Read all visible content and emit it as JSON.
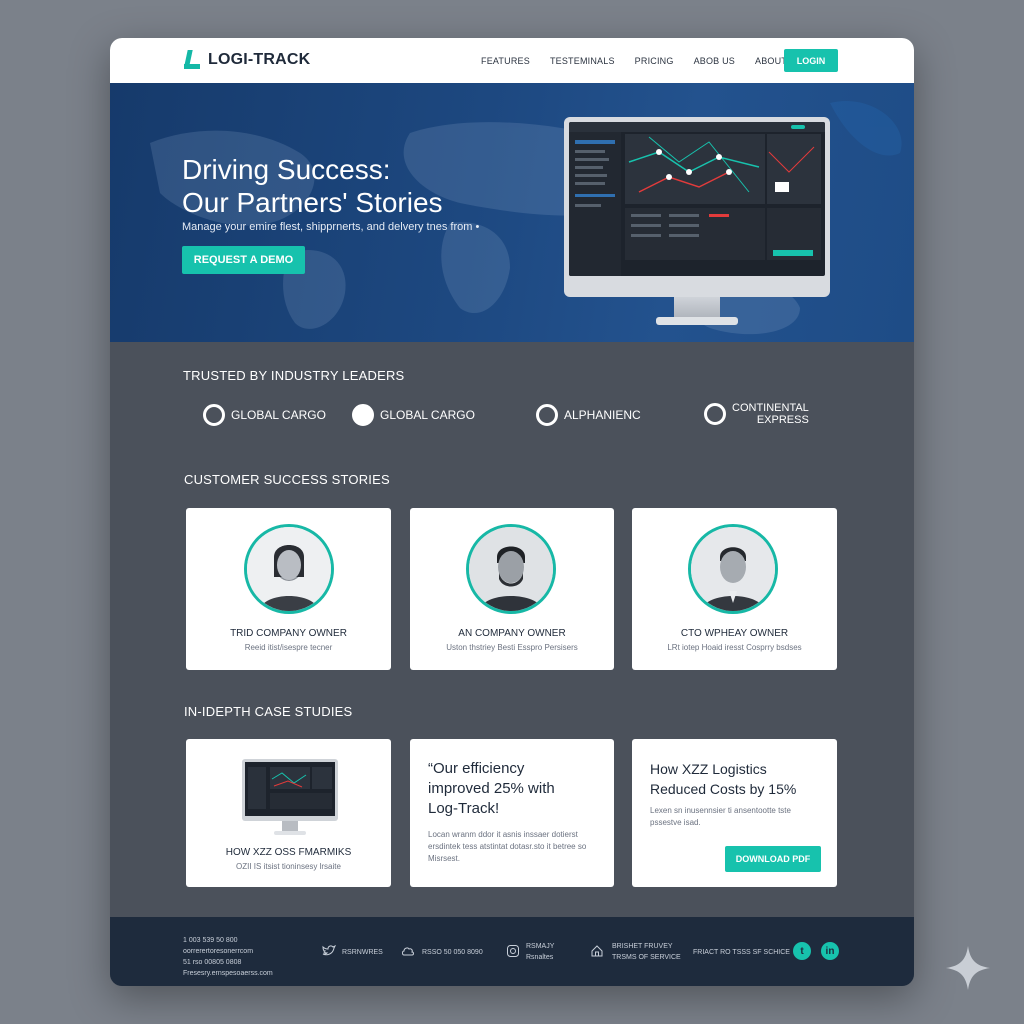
{
  "nav": {
    "logo_text": "LOGI-TRACK",
    "links": [
      "FEATURES",
      "TESTEMINALS",
      "PRICING",
      "ABOB US",
      "ABOUT US"
    ],
    "login_label": "LOGIN"
  },
  "hero": {
    "title_line1": "Driving Success:",
    "title_line2": "Our Partners' Stories",
    "subtitle": "Manage your emire flest, shipprnerts, and delvery tnes from •",
    "cta_label": "REQUEST A DEMO"
  },
  "trusted": {
    "title": "TRUSTED BY INDUSTRY LEADERS",
    "partners": [
      {
        "name": "GLOBAL CARGO"
      },
      {
        "name": "GLOBAL CARGO"
      },
      {
        "name": "ALPHANIENC"
      },
      {
        "name_line1": "CONTINENTAL",
        "name_line2": "EXPRESS"
      }
    ]
  },
  "stories": {
    "title": "CUSTOMER SUCCESS STORIES",
    "cards": [
      {
        "role": "TRID COMPANY OWNER",
        "sub": "Reeid itist/isespre tecner"
      },
      {
        "role": "AN COMPANY OWNER",
        "sub": "Uston thstriey Besti Esspro Persisers"
      },
      {
        "role": "CTO WPHEAY OWNER",
        "sub": "LRt iotep Hoaid iresst Cosprry bsdses"
      }
    ]
  },
  "cases": {
    "title": "IN-IDEPTH CASE STUDIES",
    "card1": {
      "title": "HOW XZZ OSS FMARMIKS",
      "sub": "OZII IS itsist tioninsesy lrsaite"
    },
    "card2": {
      "quote_line1": "“Our efficiency",
      "quote_line2": "improved 25% with",
      "quote_line3": "Log-Track!",
      "body_line1": "Locan wranm ddor it asnis inssaer dotierst",
      "body_line2": "ersdintek tess atstintat dotasr.sto it betree so",
      "body_line3": "Misrsest."
    },
    "card3": {
      "title_line1": "How XZZ Logistics",
      "title_line2": "Reduced Costs by 15%",
      "body_line1": "Lexen sn inusennsier ti ansentootte tste",
      "body_line2": "pssestve isad.",
      "button_label": "DOWNLOAD PDF"
    }
  },
  "footer": {
    "col1": [
      "1 003 539 50 800",
      "oorrerertoresonerrcom",
      "51 rso 00805 0808",
      "Fresesry.ernspesoaerss.com"
    ],
    "items": [
      {
        "icon": "twitter-icon",
        "label": "RSRNWRES"
      },
      {
        "icon": "cloud-icon",
        "label": "RSSO 50 050 8090"
      },
      {
        "icon": "instagram-icon",
        "label_line1": "RSMAJY",
        "label_line2": "Rsnaltes"
      },
      {
        "icon": "home-icon",
        "label_line1": "BRISHET FRUVEY",
        "label_line2": "TRSMS OF SERVICE"
      }
    ],
    "policy": "FRIACT RO TSSS SF SCHICE",
    "social": [
      {
        "icon": "twitter-icon",
        "glyph": "t"
      },
      {
        "icon": "linkedin-icon",
        "glyph": "in"
      }
    ]
  },
  "colors": {
    "accent": "#17c2ad",
    "hero": "#1d4880",
    "body": "#4b515b",
    "footer": "#1e2b3d"
  }
}
